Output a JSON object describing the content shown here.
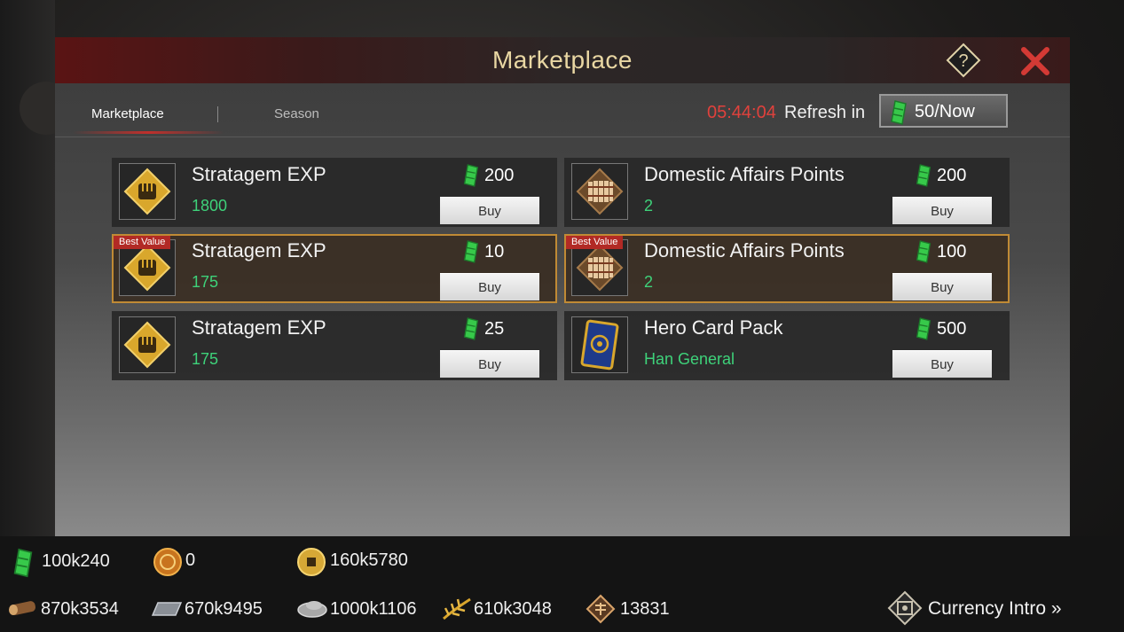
{
  "window": {
    "title": "Marketplace"
  },
  "tabs": [
    {
      "label": "Marketplace",
      "active": true
    },
    {
      "label": "Season",
      "active": false
    }
  ],
  "refresh": {
    "timer": "05:44:04",
    "label": "Refresh in",
    "button_value": "50/Now",
    "icon": "green-jade-icon"
  },
  "items": [
    {
      "name": "Stratagem EXP",
      "qty": "1800",
      "price": "200",
      "buy": "Buy",
      "badge": "",
      "icon": "fist-emblem-icon"
    },
    {
      "name": "Domestic Affairs Points",
      "qty": "2",
      "price": "200",
      "buy": "Buy",
      "badge": "",
      "icon": "bamboo-scroll-icon"
    },
    {
      "name": "Stratagem EXP",
      "qty": "175",
      "price": "10",
      "buy": "Buy",
      "badge": "Best Value",
      "icon": "fist-emblem-icon"
    },
    {
      "name": "Domestic Affairs Points",
      "qty": "2",
      "price": "100",
      "buy": "Buy",
      "badge": "Best Value",
      "icon": "bamboo-scroll-icon"
    },
    {
      "name": "Stratagem EXP",
      "qty": "175",
      "price": "25",
      "buy": "Buy",
      "badge": "",
      "icon": "fist-emblem-icon"
    },
    {
      "name": "Hero Card Pack",
      "qty": "Han General",
      "price": "500",
      "buy": "Buy",
      "badge": "",
      "icon": "hero-card-icon"
    }
  ],
  "resources": {
    "jade": "100k240",
    "gold_coin": "0",
    "copper": "160k5780",
    "wood": "870k3534",
    "iron": "670k9495",
    "stone": "1000k1106",
    "grain": "610k3048",
    "merit": "13831"
  },
  "currency_intro": {
    "label": "Currency Intro »"
  },
  "colors": {
    "accent_red": "#e0413c",
    "qty_green": "#3ed27a",
    "best_value_border": "#c08a35",
    "title_gold": "#e9d7a3"
  }
}
